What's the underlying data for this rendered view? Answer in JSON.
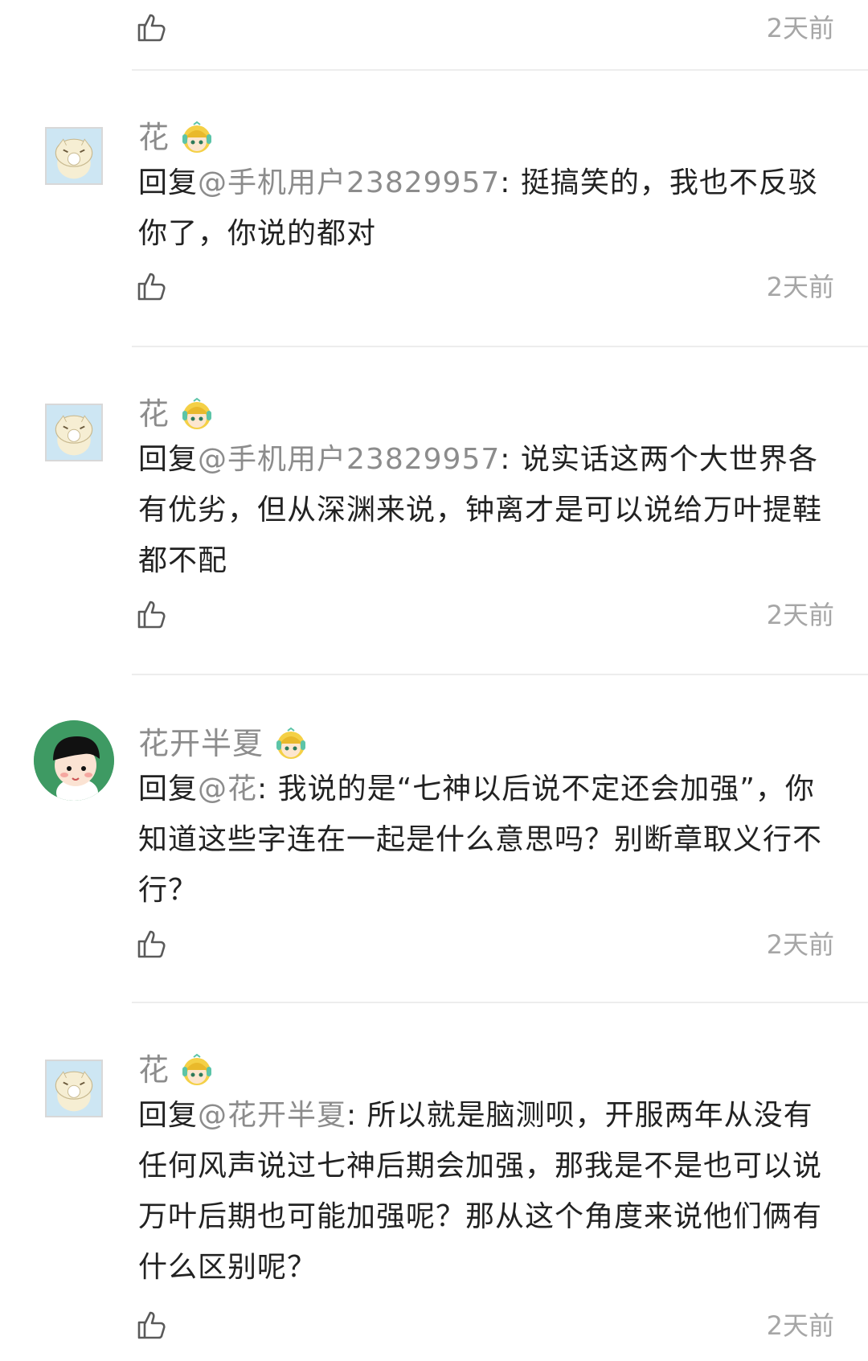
{
  "top": {
    "time": "2天前"
  },
  "comments": [
    {
      "username": "花",
      "reply_prefix": "回复",
      "mention": "@手机用户23829957",
      "colon": ": ",
      "text": "挺搞笑的，我也不反驳你了，你说的都对",
      "time": "2天前",
      "avatar_icon": "cat-avatar-icon",
      "badge_icon": "anime-girl-badge-icon"
    },
    {
      "username": "花",
      "reply_prefix": "回复",
      "mention": "@手机用户23829957",
      "colon": ": ",
      "text": "说实话这两个大世界各有优劣，但从深渊来说，钟离才是可以说给万叶提鞋都不配",
      "time": "2天前",
      "avatar_icon": "cat-avatar-icon",
      "badge_icon": "anime-girl-badge-icon"
    },
    {
      "username": "花开半夏",
      "reply_prefix": "回复",
      "mention": "@花",
      "colon": ": ",
      "text": "我说的是“七神以后说不定还会加强”，你知道这些字连在一起是什么意思吗？别断章取义行不行？",
      "time": "2天前",
      "avatar_icon": "cartoon-girl-avatar-icon",
      "badge_icon": "anime-girl-badge-icon"
    },
    {
      "username": "花",
      "reply_prefix": "回复",
      "mention": "@花开半夏",
      "colon": ": ",
      "text": "所以就是脑测呗，开服两年从没有任何风声说过七神后期会加强，那我是不是也可以说万叶后期也可能加强呢？那从这个角度来说他们俩有什么区别呢？",
      "time": "2天前",
      "avatar_icon": "cat-avatar-icon",
      "badge_icon": "anime-girl-badge-icon"
    }
  ]
}
